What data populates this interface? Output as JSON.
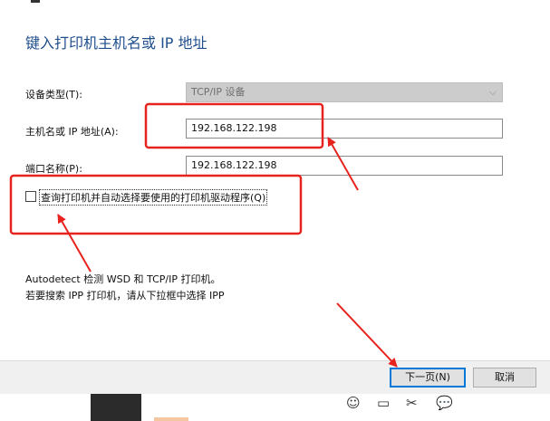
{
  "dialog": {
    "title": "键入打印机主机名或 IP 地址",
    "device_type": {
      "label": "设备类型(T):",
      "value": "TCP/IP 设备"
    },
    "host": {
      "label": "主机名或 IP 地址(A):",
      "value": "192.168.122.198"
    },
    "port": {
      "label": "端口名称(P):",
      "value": "192.168.122.198"
    },
    "query_checkbox": {
      "label": "查询打印机并自动选择要使用的打印机驱动程序(Q)",
      "checked": false
    },
    "hint_line1": "Autodetect 检测 WSD 和 TCP/IP 打印机。",
    "hint_line2": "若要搜索 IPP 打印机，请从下拉框中选择 IPP"
  },
  "buttons": {
    "next": "下一页(N)",
    "cancel": "取消"
  },
  "annotations": {
    "color": "#e8231e"
  },
  "icons": [
    "emoji-icon",
    "folder-icon",
    "scissors-icon",
    "chat-bubble-icon"
  ]
}
